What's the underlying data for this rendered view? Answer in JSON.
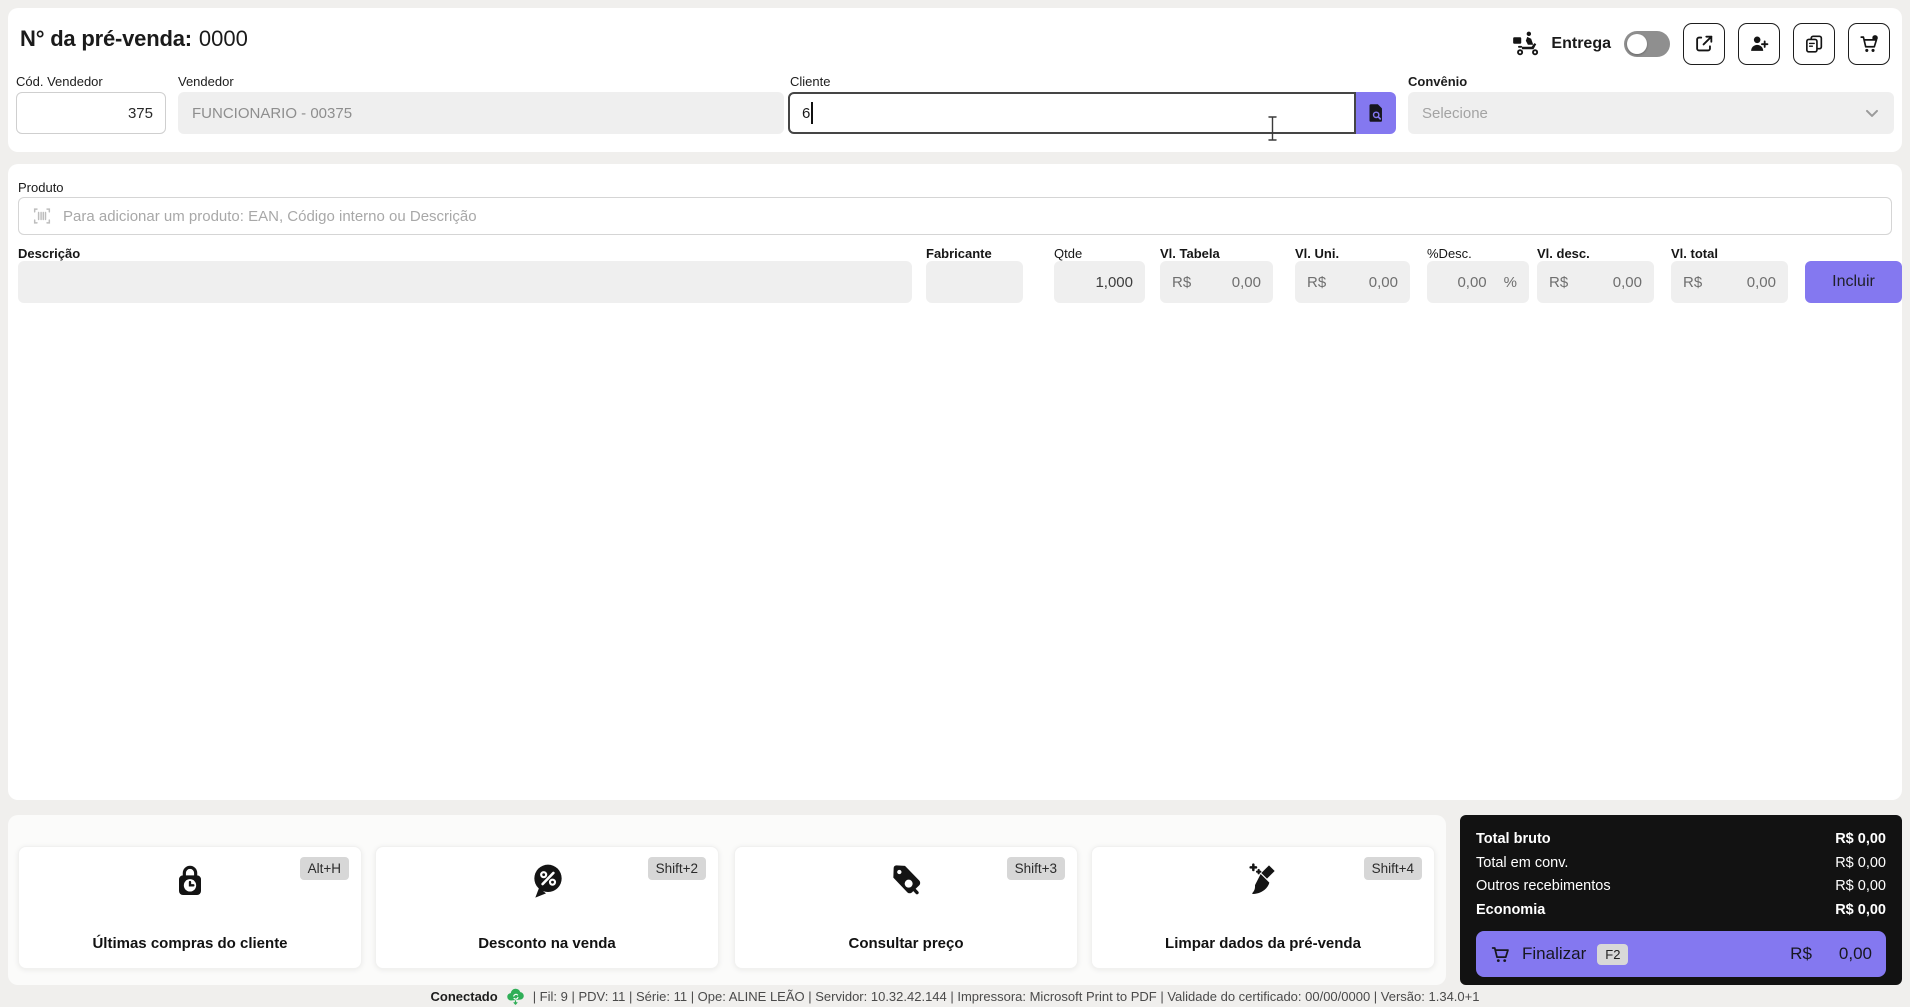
{
  "app": {
    "title_label": "N° da pré-venda:",
    "title_value": "0000"
  },
  "header": {
    "delivery_label": "Entrega",
    "delivery_toggle_on": false,
    "icon_buttons": [
      "share-icon",
      "add-user-icon",
      "copy-icon",
      "cart-badge-icon"
    ]
  },
  "form": {
    "cod_vendedor_label": "Cód. Vendedor",
    "cod_vendedor_value": "375",
    "vendedor_label": "Vendedor",
    "vendedor_value": "FUNCIONARIO - 00375",
    "cliente_label": "Cliente",
    "cliente_value": "6",
    "convenio_label": "Convênio",
    "convenio_placeholder": "Selecione"
  },
  "product": {
    "label": "Produto",
    "placeholder": "Para adicionar um produto: EAN, Código interno ou Descrição",
    "columns": {
      "descricao": "Descrição",
      "fabricante": "Fabricante",
      "qtde": "Qtde",
      "vl_tabela": "Vl. Tabela",
      "vl_uni": "Vl. Uni.",
      "desc_pct": "%Desc.",
      "vl_desc": "Vl. desc.",
      "vl_total": "Vl. total"
    },
    "entry": {
      "descricao": "",
      "fabricante": "",
      "qtde": "1,000",
      "currency": "R$",
      "vl_tabela": "0,00",
      "vl_uni": "0,00",
      "desc_pct": "0,00",
      "desc_pct_suffix": "%",
      "vl_desc": "0,00",
      "vl_total": "0,00"
    },
    "incluir_label": "Incluir"
  },
  "actions": [
    {
      "label": "Últimas compras do cliente",
      "shortcut": "Alt+H",
      "icon": "bag-clock-icon"
    },
    {
      "label": "Desconto na venda",
      "shortcut": "Shift+2",
      "icon": "discount-bubble-icon"
    },
    {
      "label": "Consultar preço",
      "shortcut": "Shift+3",
      "icon": "price-tag-search-icon"
    },
    {
      "label": "Limpar dados da pré-venda",
      "shortcut": "Shift+4",
      "icon": "broom-sparkle-icon"
    }
  ],
  "totals": {
    "rows": [
      {
        "label": "Total bruto",
        "value": "R$ 0,00"
      },
      {
        "label": "Total em conv.",
        "value": "R$ 0,00"
      },
      {
        "label": "Outros recebimentos",
        "value": "R$ 0,00"
      },
      {
        "label": "Economia",
        "value": "R$ 0,00"
      }
    ],
    "finalize_label": "Finalizar",
    "finalize_shortcut": "F2",
    "finalize_currency": "R$",
    "finalize_value": "0,00"
  },
  "statusbar": {
    "connected_label": "Conectado",
    "details": "| Fil: 9 | PDV: 11 | Série: 11 | Ope: ALINE LEÃO | Servidor: 10.32.42.144 | Impressora: Microsoft Print to PDF | Validade do certificado: 00/00/0000 | Versão: 1.34.0+1"
  },
  "colors": {
    "accent": "#8478F0",
    "panel_dark": "#121212",
    "connected_green": "#2FAE57"
  }
}
